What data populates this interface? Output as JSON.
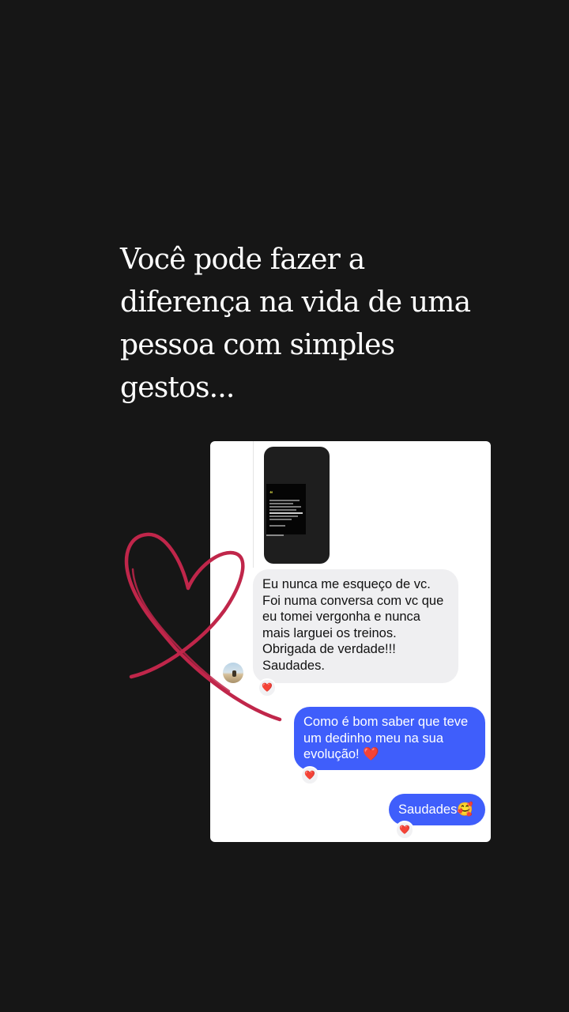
{
  "caption": "Você pode fazer a diferença na vida de uma pessoa com simples gestos...",
  "messages": {
    "received": "Eu nunca me esqueço de vc.\nFoi numa conversa com vc que eu tomei vergonha e nunca mais larguei os treinos.\nObrigada de verdade!!!\nSaudades.",
    "sent_1": "Como é bom saber que teve um dedinho meu na sua evolução! ❤️",
    "sent_2": "Saudades🥰"
  },
  "reaction_emoji": "❤️",
  "colors": {
    "background": "#161616",
    "sent_bubble": "#3f5efb",
    "received_bubble": "#efeff1",
    "heart_doodle": "#c0264a"
  }
}
